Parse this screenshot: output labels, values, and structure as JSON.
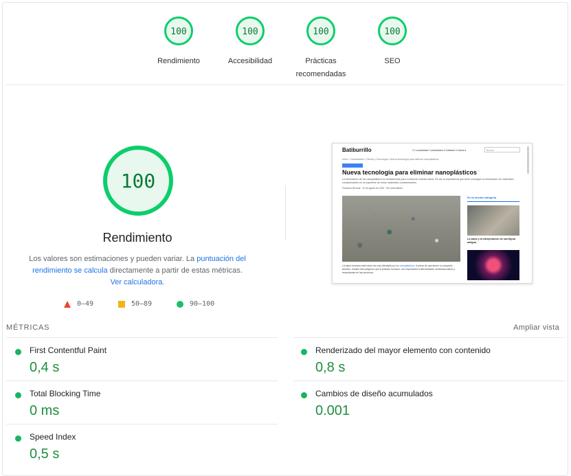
{
  "top_scores": [
    {
      "value": "100",
      "label": "Rendimiento"
    },
    {
      "value": "100",
      "label": "Accesibilidad"
    },
    {
      "value": "100",
      "label": "Prácticas recomendadas"
    },
    {
      "value": "100",
      "label": "SEO"
    }
  ],
  "performance": {
    "score": "100",
    "score_fraction": 1.0,
    "title": "Rendimiento",
    "desc_prefix": "Los valores son estimaciones y pueden variar. La ",
    "desc_link1": "puntuación del rendimiento se calcula",
    "desc_middle": " directamente a partir de estas métricas. ",
    "desc_link2": "Ver calculadora",
    "desc_suffix": "."
  },
  "legend": {
    "fail": "0–49",
    "average": "50–89",
    "pass": "90–100"
  },
  "screenshot": {
    "site_name": "Batiburrillo",
    "nav_links": "Localidades   Curiosidades ▾   Software ▾   Varios ▾",
    "search_placeholder": "Buscar",
    "breadcrumb": "Inicio / Curiosidades / Ciencia y Tecnología / Nueva tecnología para eliminar nanoplásticos",
    "article_title": "Nueva tecnología para eliminar nanoplásticos",
    "subtitle": "La eliminación de los nanoplásticos es fundamental para conservar nuestra salud. De ahí la importancia que tiene conseguir la eliminación de materiales contaminantes en la superficie de estos materiales contaminantes.",
    "author": "Francisco Bruzual  ·  19 de agosto de 2024  ·  Sin comentarios",
    "caption_prefix": "La salud humana está cada vez más afectada por los ",
    "caption_link": "nanoplásticos",
    "caption_rest": ". A pesar de que tienen un pequeño tamaño, resulta más peligroso que el plástico humano, con importantes enfermedades cardiovasculares y respiratorias en las personas.",
    "side_title": "En la misma categoría",
    "side_item1": "La salud y la interpretación de una figura antigua"
  },
  "metrics": {
    "heading": "MÉTRICAS",
    "expand_label": "Ampliar vista",
    "items": [
      {
        "name": "First Contentful Paint",
        "value": "0,4 s"
      },
      {
        "name": "Renderizado del mayor elemento con contenido",
        "value": "0,8 s"
      },
      {
        "name": "Total Blocking Time",
        "value": "0 ms"
      },
      {
        "name": "Cambios de diseño acumulados",
        "value": "0.001"
      },
      {
        "name": "Speed Index",
        "value": "0,5 s"
      }
    ]
  },
  "colors": {
    "pass_green": "#0cce6b",
    "pass_fill": "#e8f8ee",
    "score_text": "#0a7a37",
    "value_green": "#1e8e3e",
    "fail_red": "#ea4335",
    "average_orange": "#f2b31a",
    "link_blue": "#1a73e8"
  }
}
